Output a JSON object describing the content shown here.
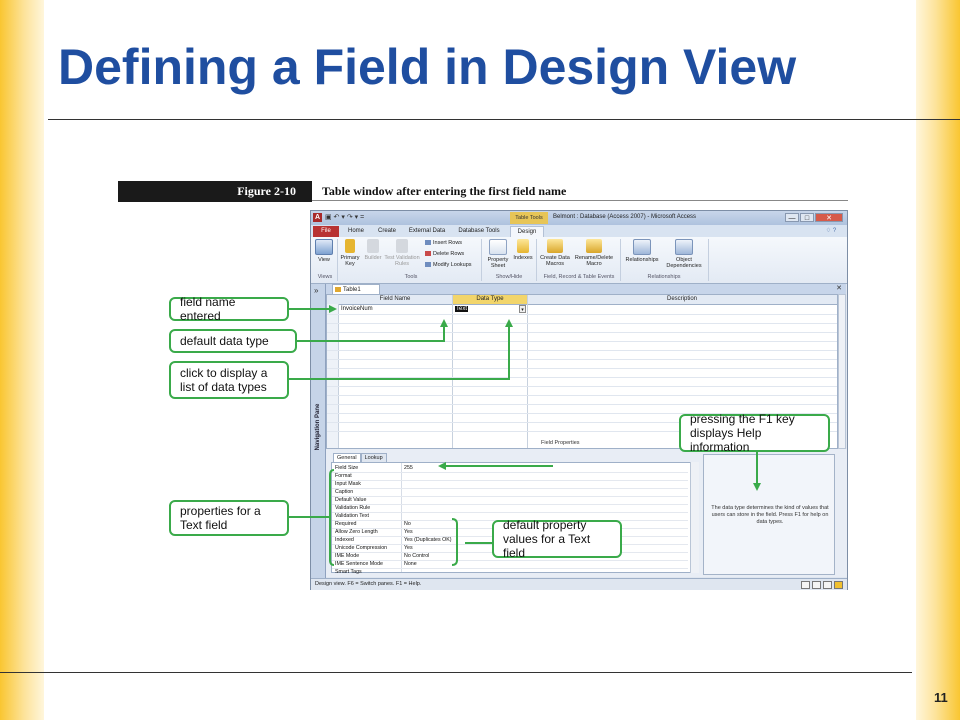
{
  "slide": {
    "title": "Defining a Field in Design View",
    "page_number": "11"
  },
  "figure": {
    "label": "Figure 2-10",
    "caption": "Table window after entering the first field name"
  },
  "window": {
    "title": "Belmont : Database (Access 2007) - Microsoft Access",
    "context_tab": "Table Tools",
    "app_icon": "A",
    "qat": "▣ ↶ ▾ ↷ ▾ =",
    "controls": {
      "minimize": "—",
      "maximize": "□",
      "close": "✕"
    }
  },
  "ribbon_tabs": [
    "File",
    "Home",
    "Create",
    "External Data",
    "Database Tools",
    "Design"
  ],
  "ribbon": {
    "view": "View",
    "primary_key": "Primary Key",
    "builder": "Builder",
    "test_validation_rules": "Test Validation Rules",
    "insert_rows": "Insert Rows",
    "delete_rows": "Delete Rows",
    "modify_lookups": "Modify Lookups",
    "property_sheet": "Property Sheet",
    "indexes": "Indexes",
    "create_data_macros": "Create Data Macros",
    "rename_delete_macro": "Rename/Delete Macro",
    "relationships": "Relationships",
    "object_dependencies": "Object Dependencies",
    "groups": {
      "views": "Views",
      "tools": "Tools",
      "show_hide": "Show/Hide",
      "field_events": "Field, Record & Table Events",
      "relationships": "Relationships"
    }
  },
  "navigation_pane": {
    "label": "Navigation Pane",
    "chevron": "»"
  },
  "document_tab": {
    "label": "Table1",
    "close": "✕"
  },
  "grid": {
    "headers": {
      "field_name": "Field Name",
      "data_type": "Data Type",
      "description": "Description"
    },
    "row": {
      "field_name": "InvoiceNum",
      "data_type": "Text"
    },
    "dropdown_glyph": "▾",
    "row_arrow": "▸"
  },
  "field_properties_label": "Field Properties",
  "property_tabs": [
    "General",
    "Lookup"
  ],
  "properties": [
    {
      "name": "Field Size",
      "value": "255"
    },
    {
      "name": "Format",
      "value": ""
    },
    {
      "name": "Input Mask",
      "value": ""
    },
    {
      "name": "Caption",
      "value": ""
    },
    {
      "name": "Default Value",
      "value": ""
    },
    {
      "name": "Validation Rule",
      "value": ""
    },
    {
      "name": "Validation Text",
      "value": ""
    },
    {
      "name": "Required",
      "value": "No"
    },
    {
      "name": "Allow Zero Length",
      "value": "Yes"
    },
    {
      "name": "Indexed",
      "value": "Yes (Duplicates OK)"
    },
    {
      "name": "Unicode Compression",
      "value": "Yes"
    },
    {
      "name": "IME Mode",
      "value": "No Control"
    },
    {
      "name": "IME Sentence Mode",
      "value": "None"
    },
    {
      "name": "Smart Tags",
      "value": ""
    }
  ],
  "help_text": "The data type determines the kind of values that users can store in the field. Press F1 for help on data types.",
  "status_bar": "Design view.  F6 = Switch panes.  F1 = Help.",
  "callouts": {
    "field_name_entered": "field name entered",
    "default_data_type": "default data type",
    "click_to_display": "click to display a list of data types",
    "properties_for_text": "properties for a Text field",
    "default_property_values": "default property values for a Text field",
    "pressing_f1": "pressing the F1 key displays Help information"
  },
  "colors": {
    "title_blue": "#1f4ea0",
    "callout_border": "#3aaa4a",
    "side_gold": "#f9c631",
    "file_tab_red": "#b83232",
    "context_tab_gold": "#e7c557"
  }
}
